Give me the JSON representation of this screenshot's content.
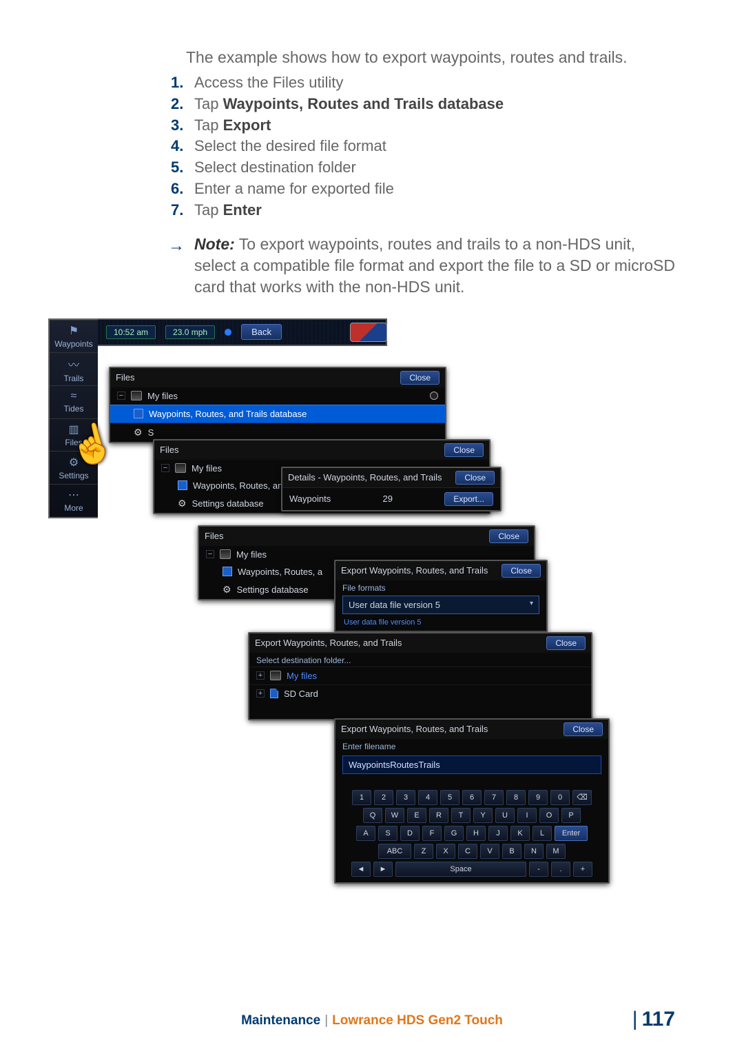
{
  "intro": "The example shows how to export waypoints, routes and trails.",
  "steps": {
    "s1": "Access the Files utility",
    "s2a": "Tap ",
    "s2b": "Waypoints, Routes and Trails database",
    "s3a": "Tap ",
    "s3b": "Export",
    "s4": "Select the desired file format",
    "s5": "Select destination folder",
    "s6": "Enter a name for exported file",
    "s7a": "Tap ",
    "s7b": "Enter"
  },
  "note": {
    "arrow": "→",
    "label": "Note:",
    "text": " To export waypoints, routes and trails to a non-HDS unit, select a compatible file format and export the file to a SD or microSD card that works with the non-HDS unit."
  },
  "topbar": {
    "time": "10:52 am",
    "speed": "23.0 mph",
    "back": "Back"
  },
  "sidebar": {
    "waypoints": "Waypoints",
    "trails": "Trails",
    "tides": "Tides",
    "files": "Files",
    "settings": "Settings",
    "more": "More"
  },
  "ui": {
    "files_title": "Files",
    "close": "Close",
    "my_files": "My files",
    "wpdb": "Waypoints, Routes, and Trails database",
    "wpdb_short": "Waypoints, Routes, and",
    "wpdb_short2": "Waypoints, Routes, a",
    "settings_db": "Settings database",
    "details_title": "Details - Waypoints, Routes, and Trails",
    "waypoints_label": "Waypoints",
    "waypoints_count": "29",
    "export": "Export...",
    "export_title": "Export Waypoints, Routes, and Trails",
    "file_formats": "File formats",
    "file_format_sel": "User data file version 5",
    "file_format_hint": "User data file version 5",
    "select_dest": "Select destination folder...",
    "sd_card": "SD Card",
    "enter_filename": "Enter filename",
    "filename_value": "WaypointsRoutesTrails",
    "space": "Space",
    "enter": "Enter",
    "abc": "ABC"
  },
  "keyboard": {
    "r1": [
      "1",
      "2",
      "3",
      "4",
      "5",
      "6",
      "7",
      "8",
      "9",
      "0",
      "⌫"
    ],
    "r2": [
      "Q",
      "W",
      "E",
      "R",
      "T",
      "Y",
      "U",
      "I",
      "O",
      "P"
    ],
    "r3": [
      "A",
      "S",
      "D",
      "F",
      "G",
      "H",
      "J",
      "K",
      "L"
    ],
    "r4_left": "ABC",
    "r4": [
      "Z",
      "X",
      "C",
      "V",
      "B",
      "N",
      "M"
    ],
    "r5_left": [
      "◄",
      "►"
    ],
    "r5_right": [
      "-",
      ".",
      "+"
    ]
  },
  "footer": {
    "section": "Maintenance",
    "sep": "|",
    "product": "Lowrance HDS Gen2 Touch",
    "page": "117"
  }
}
